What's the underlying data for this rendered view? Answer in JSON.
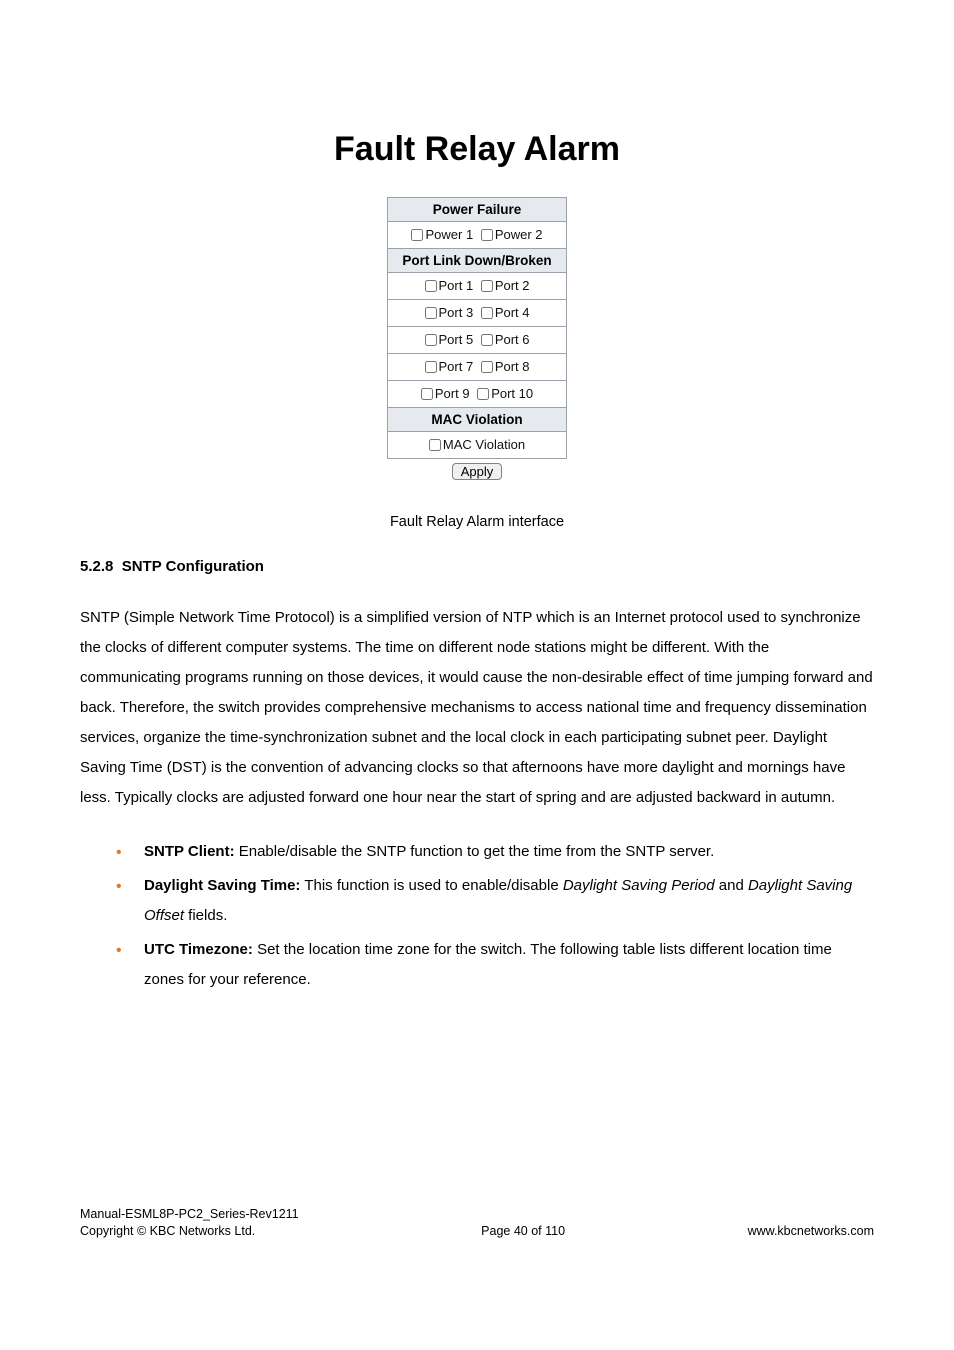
{
  "panel": {
    "title": "Fault Relay Alarm",
    "sections": {
      "power_failure": {
        "header": "Power Failure",
        "items": [
          "Power 1",
          "Power 2"
        ]
      },
      "port_link": {
        "header": "Port Link Down/Broken",
        "rows": [
          [
            "Port 1",
            "Port 2"
          ],
          [
            "Port 3",
            "Port 4"
          ],
          [
            "Port 5",
            "Port 6"
          ],
          [
            "Port 7",
            "Port 8"
          ],
          [
            "Port 9",
            "Port 10"
          ]
        ]
      },
      "mac_violation": {
        "header": "MAC Violation",
        "item": "MAC Violation"
      }
    },
    "apply_label": "Apply",
    "caption": "Fault Relay Alarm interface"
  },
  "section": {
    "number": "5.2.8",
    "title": "SNTP Configuration"
  },
  "paragraph": "SNTP (Simple Network Time Protocol) is a simplified version of NTP which is an Internet protocol used to synchronize the clocks of different computer systems. The time on different node stations might be different. With the communicating programs running on those devices, it would cause the non-desirable effect of time jumping forward and back. Therefore, the switch provides comprehensive mechanisms to access national time and frequency dissemination services, organize the time-synchronization subnet and the local clock in each participating subnet peer. Daylight Saving Time (DST) is the convention of advancing clocks so that afternoons have more daylight and mornings have less. Typically clocks are adjusted forward one hour near the start of spring and are adjusted backward in autumn.",
  "bullets": {
    "b1": {
      "label": "SNTP Client:",
      "text": " Enable/disable the SNTP function to get the time from the SNTP server."
    },
    "b2": {
      "label": "Daylight Saving Time:",
      "text_a": " This function is used to enable/disable ",
      "ital_a": "Daylight Saving Period",
      "text_b": " and ",
      "ital_b": "Daylight Saving Offset",
      "text_c": " fields."
    },
    "b3": {
      "label": "UTC Timezone:",
      "text": " Set the location time zone for the switch. The following table lists different location time zones for your reference."
    }
  },
  "footer": {
    "line1": "Manual-ESML8P-PC2_Series-Rev1211",
    "line2": "Copyright © KBC Networks Ltd.",
    "center": "Page 40 of 110",
    "right": "www.kbcnetworks.com"
  }
}
